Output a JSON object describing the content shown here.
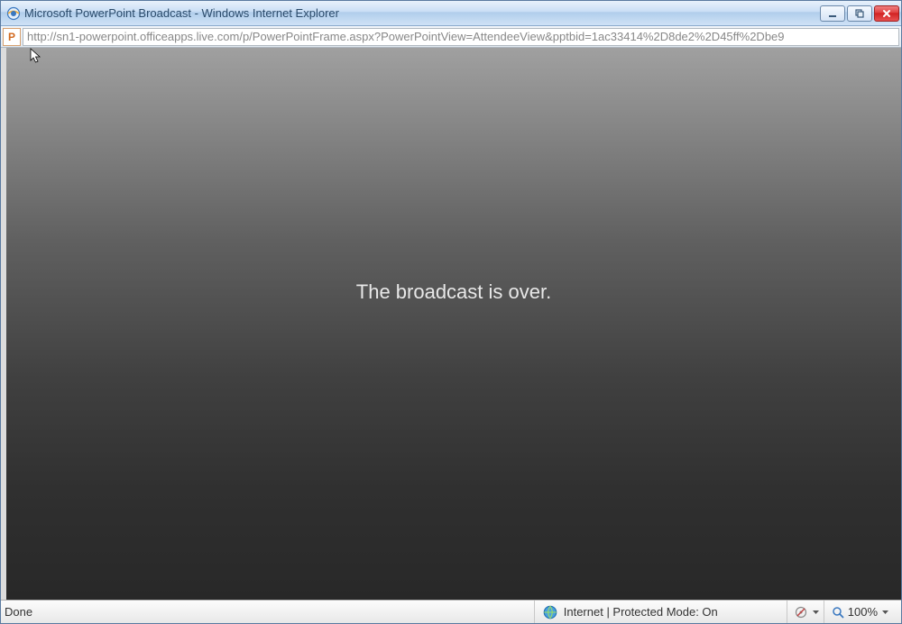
{
  "window": {
    "title": "Microsoft PowerPoint Broadcast - Windows Internet Explorer"
  },
  "addressbar": {
    "url": "http://sn1-powerpoint.officeapps.live.com/p/PowerPointFrame.aspx?PowerPointView=AttendeeView&pptbid=1ac33414%2D8de2%2D45ff%2Dbe9",
    "page_icon_letter": "P"
  },
  "content": {
    "message": "The broadcast is over."
  },
  "statusbar": {
    "status_text": "Done",
    "zone_text": "Internet | Protected Mode: On",
    "zoom_level": "100%"
  }
}
